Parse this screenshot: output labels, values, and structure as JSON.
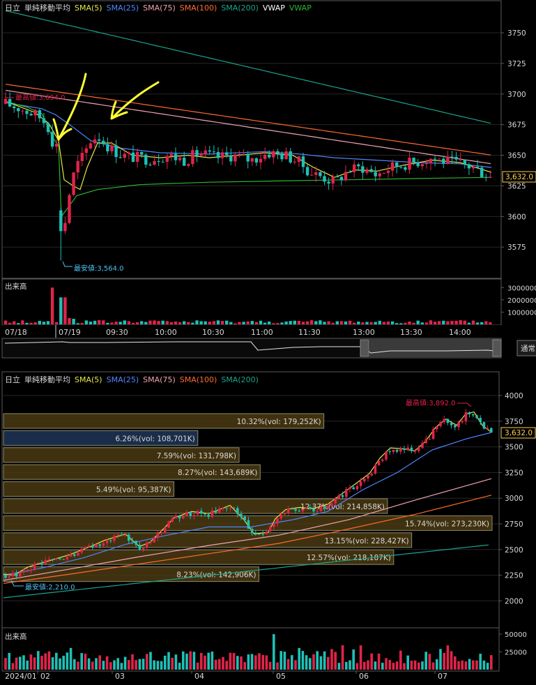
{
  "colors": {
    "background": "#000000",
    "panel_border": "#5a5a5a",
    "grid": "#262626",
    "text": "#d8d8d8",
    "up_candle": "#e0244a",
    "down_candle": "#1fc0b6",
    "sma5": "#e6e64a",
    "sma25": "#4f86ff",
    "sma75": "#f2a3b1",
    "sma100": "#ff6a2e",
    "sma200": "#1aa58c",
    "vwap": "#ffffff",
    "vwap_green": "#2fb52f",
    "price_tag": "#ffd24a",
    "high_label": "#e0244a",
    "low_label": "#4fc3f7",
    "annotation": "#ffff33",
    "profile_fill": "#4a3a12",
    "profile_highlight": "#1f3557",
    "volume_bar": "#e0244a",
    "volume_bar_down": "#1fc0b6"
  },
  "charts": {
    "top": {
      "legend": {
        "symbol": "日立",
        "indicator": "単純移動平均",
        "items": [
          "SMA(5)",
          "SMA(25)",
          "SMA(75)",
          "SMA(100)",
          "SMA(200)",
          "VWAP",
          "VWAP"
        ]
      },
      "y_ticks": [
        "3750",
        "3725",
        "3700",
        "3675",
        "3650",
        "3625",
        "3600",
        "3575"
      ],
      "current_price_label": "3,632.0",
      "high_label": "最高値:3,694.0",
      "low_label": "最安値:3,564.0",
      "volume_label": "出来高",
      "volume_ticks": [
        "3000000",
        "2000000",
        "1000000"
      ],
      "x_labels": [
        "07/18",
        "07/19",
        "09:30",
        "10:00",
        "10:30",
        "11:00",
        "11:30",
        "13:00",
        "13:30",
        "14:00"
      ],
      "scroll_button": "通常"
    },
    "bottom": {
      "legend": {
        "symbol": "日立",
        "indicator": "単純移動平均",
        "items": [
          "SMA(5)",
          "SMA(25)",
          "SMA(75)",
          "SMA(100)",
          "SMA(200)"
        ]
      },
      "y_ticks": [
        "4000",
        "3750",
        "3500",
        "3250",
        "3000",
        "2750",
        "2500",
        "2250",
        "2000"
      ],
      "current_price_label": "3,632.0",
      "high_label": "最高値:3,892.0",
      "low_label": "最安値:2,210.0",
      "volume_label": "出来高",
      "volume_ticks": [
        "50000",
        "25000"
      ],
      "x_labels": [
        "2024/01",
        "02",
        "03",
        "04",
        "05",
        "06",
        "07"
      ],
      "volume_profile": [
        {
          "label": "10.32%(vol: 179,252K)",
          "share": 10.32,
          "highlight": false
        },
        {
          "label": "6.26%(vol: 108,701K)",
          "share": 6.26,
          "highlight": true
        },
        {
          "label": "7.59%(vol: 131,798K)",
          "share": 7.59,
          "highlight": false
        },
        {
          "label": "8.27%(vol: 143,689K)",
          "share": 8.27,
          "highlight": false
        },
        {
          "label": "5.49%(vol: 95,387K)",
          "share": 5.49,
          "highlight": false
        },
        {
          "label": "12.37%(vol: 214,858K)",
          "share": 12.37,
          "highlight": false
        },
        {
          "label": "15.74%(vol: 273,230K)",
          "share": 15.74,
          "highlight": false
        },
        {
          "label": "13.15%(vol: 228,427K)",
          "share": 13.15,
          "highlight": false
        },
        {
          "label": "12.57%(vol: 218,187K)",
          "share": 12.57,
          "highlight": false
        },
        {
          "label": "8.23%(vol: 142,906K)",
          "share": 8.23,
          "highlight": false
        }
      ]
    }
  },
  "chart_data": [
    {
      "type": "candlestick",
      "title": "",
      "ylim": [
        3555,
        3770
      ],
      "high": 3694.0,
      "low": 3564.0,
      "last": 3632.0,
      "volume_ylim": [
        0,
        3300000
      ],
      "volume_peak": 3000000,
      "series": [
        {
          "name": "SMA(5)"
        },
        {
          "name": "SMA(25)"
        },
        {
          "name": "SMA(75)"
        },
        {
          "name": "SMA(100)"
        },
        {
          "name": "SMA(200)"
        },
        {
          "name": "VWAP"
        },
        {
          "name": "VWAP"
        }
      ]
    },
    {
      "type": "candlestick",
      "title": "",
      "ylim": [
        1930,
        4070
      ],
      "high": 3892.0,
      "low": 2210.0,
      "last": 3632.0,
      "volume_ylim": [
        0,
        55000
      ],
      "series": [
        {
          "name": "SMA(5)"
        },
        {
          "name": "SMA(25)"
        },
        {
          "name": "SMA(75)"
        },
        {
          "name": "SMA(100)"
        },
        {
          "name": "SMA(200)"
        }
      ]
    }
  ]
}
